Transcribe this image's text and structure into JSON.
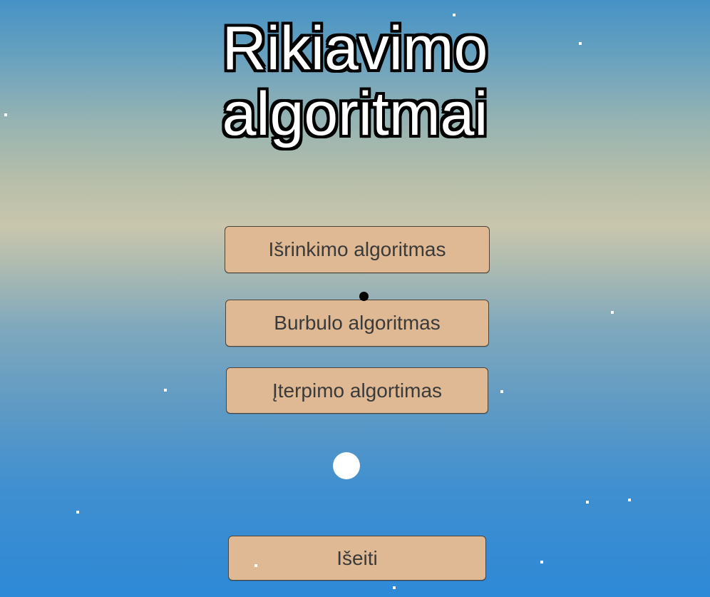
{
  "title": {
    "line1": "Rikiavimo",
    "line2": "algoritmai"
  },
  "menu": {
    "selection_sort": "Išrinkimo algoritmas",
    "bubble_sort": "Burbulo algoritmas",
    "insertion_sort": "Įterpimo algortimas",
    "exit": "Išeiti"
  },
  "colors": {
    "button_fill": "#dfb994",
    "button_border": "#4d4339",
    "button_text": "#3a3a3a",
    "title_fill": "#ffffff",
    "title_outline": "#000000"
  },
  "decorations": {
    "stars": "star-icon",
    "moon": "crescent-moon-icon",
    "ball": "white-circle",
    "cursor_dot": "black-dot"
  }
}
